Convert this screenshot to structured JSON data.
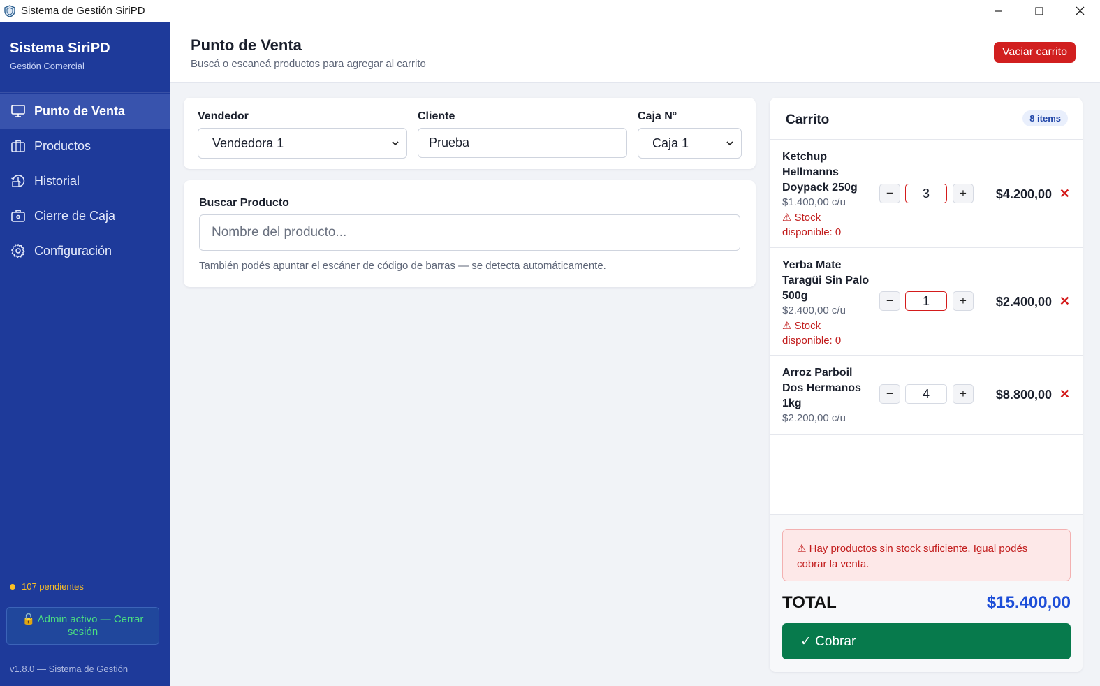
{
  "window": {
    "title": "Sistema de Gestión SiriPD",
    "minimize": "—",
    "maximize": "☐",
    "close": "✕"
  },
  "sidebar": {
    "brand_title": "Sistema SiriPD",
    "brand_subtitle": "Gestión Comercial",
    "items": [
      {
        "label": "Punto de Venta",
        "icon": "monitor-icon",
        "active": true
      },
      {
        "label": "Productos",
        "icon": "briefcase-icon"
      },
      {
        "label": "Historial",
        "icon": "history-icon"
      },
      {
        "label": "Cierre de Caja",
        "icon": "cashbox-icon"
      },
      {
        "label": "Configuración",
        "icon": "gear-icon"
      }
    ],
    "pending": "107 pendientes",
    "admin_button": "🔓 Admin activo — Cerrar sesión",
    "version": "v1.8.0 — Sistema de Gestión"
  },
  "header": {
    "title": "Punto de Venta",
    "subtitle": "Buscá o escaneá productos para agregar al carrito",
    "empty_cart": "Vaciar carrito"
  },
  "form": {
    "vendor_label": "Vendedor",
    "vendor_value": "Vendedora 1",
    "client_label": "Cliente",
    "client_value": "Prueba",
    "register_label": "Caja N°",
    "register_value": "Caja 1"
  },
  "search": {
    "label": "Buscar Producto",
    "placeholder": "Nombre del producto...",
    "hint": "También podés apuntar el escáner de código de barras — se detecta automáticamente."
  },
  "cart": {
    "title": "Carrito",
    "count_badge": "8 items",
    "items": [
      {
        "name": "Ketchup Hellmanns Doypack 250g",
        "unit_price": "$1.400,00 c/u",
        "warning": "⚠ Stock disponible: 0",
        "qty": "3",
        "total": "$4.200,00"
      },
      {
        "name": "Yerba Mate Taragüi Sin Palo 500g",
        "unit_price": "$2.400,00 c/u",
        "warning": "⚠ Stock disponible: 0",
        "qty": "1",
        "total": "$2.400,00"
      },
      {
        "name": "Arroz Parboil Dos Hermanos 1kg",
        "unit_price": "$2.200,00 c/u",
        "qty": "4",
        "total": "$8.800,00"
      }
    ],
    "minus": "−",
    "plus": "+",
    "remove": "✕",
    "alert": "⚠ Hay productos sin stock suficiente. Igual podés cobrar la venta.",
    "total_label": "TOTAL",
    "total_value": "$15.400,00",
    "charge_button": "✓ Cobrar"
  },
  "colors": {
    "sidebar": "#1e3a9a",
    "active_nav": "#3853ad",
    "danger": "#d11f1f",
    "success": "#077a4c",
    "total": "#1d4ed8"
  }
}
